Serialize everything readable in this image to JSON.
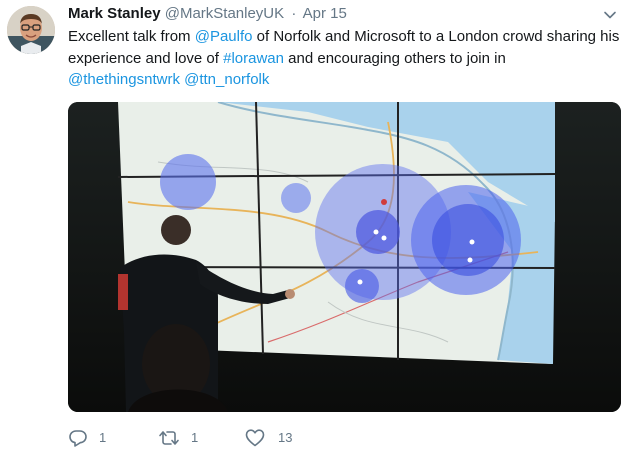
{
  "tweet": {
    "display_name": "Mark Stanley",
    "handle": "@MarkStanleyUK",
    "separator": "·",
    "date": "Apr 15",
    "text_parts": {
      "p1": "Excellent talk from ",
      "m1": "@Paulfo",
      "p2": " of Norfolk and Microsoft to a London crowd sharing his experience and love of ",
      "h1": "#lorawan",
      "p3": " and encouraging others to join in ",
      "m2": "@thethingsntwrk",
      "p4": " ",
      "m3": "@ttn_norfolk"
    },
    "icons": {
      "caret": "chevron-down-icon",
      "reply": "reply-icon",
      "retweet": "retweet-icon",
      "like": "heart-icon"
    },
    "counts": {
      "replies": "1",
      "retweets": "1",
      "likes": "13"
    },
    "colors": {
      "link": "#1b95e0",
      "muted": "#657786",
      "text": "#14171a"
    }
  }
}
